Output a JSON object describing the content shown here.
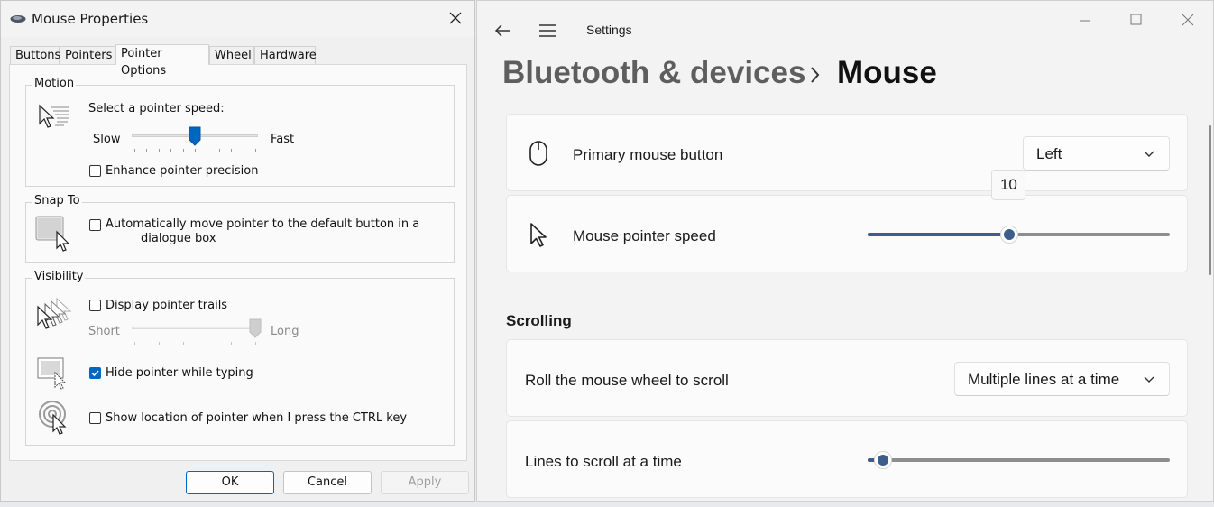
{
  "mouse_properties": {
    "title": "Mouse Properties",
    "tabs": [
      "Buttons",
      "Pointers",
      "Pointer Options",
      "Wheel",
      "Hardware"
    ],
    "active_tab": "Pointer Options",
    "motion": {
      "group_label": "Motion",
      "speed_label": "Select a pointer speed:",
      "slow_label": "Slow",
      "fast_label": "Fast",
      "speed_level": 0.5,
      "enhance_label": "Enhance pointer precision",
      "enhance_checked": false
    },
    "snap_to": {
      "group_label": "Snap To",
      "auto_move_label_line1": "Automatically move pointer to the default button in a",
      "auto_move_label_line2": "dialogue box",
      "auto_move_checked": false
    },
    "visibility": {
      "group_label": "Visibility",
      "trails_label": "Display pointer trails",
      "trails_checked": false,
      "short_label": "Short",
      "long_label": "Long",
      "trails_level": 1.0,
      "hide_label": "Hide pointer while typing",
      "hide_checked": true,
      "ctrl_label": "Show location of pointer when I press the CTRL key",
      "ctrl_checked": false
    },
    "buttons": {
      "ok": "OK",
      "cancel": "Cancel",
      "apply": "Apply"
    }
  },
  "settings": {
    "app_title": "Settings",
    "breadcrumb": {
      "parent": "Bluetooth & devices",
      "current": "Mouse"
    },
    "primary_button": {
      "label": "Primary mouse button",
      "value": "Left"
    },
    "pointer_speed": {
      "label": "Mouse pointer speed",
      "value": "10",
      "level": 0.47
    },
    "scrolling": {
      "heading": "Scrolling",
      "roll_label": "Roll the mouse wheel to scroll",
      "roll_value": "Multiple lines at a time",
      "lines_label": "Lines to scroll at a time",
      "lines_level": 0.05
    }
  },
  "colors": {
    "accent": "#0067c0",
    "slider_accent": "#3d5e8a"
  }
}
